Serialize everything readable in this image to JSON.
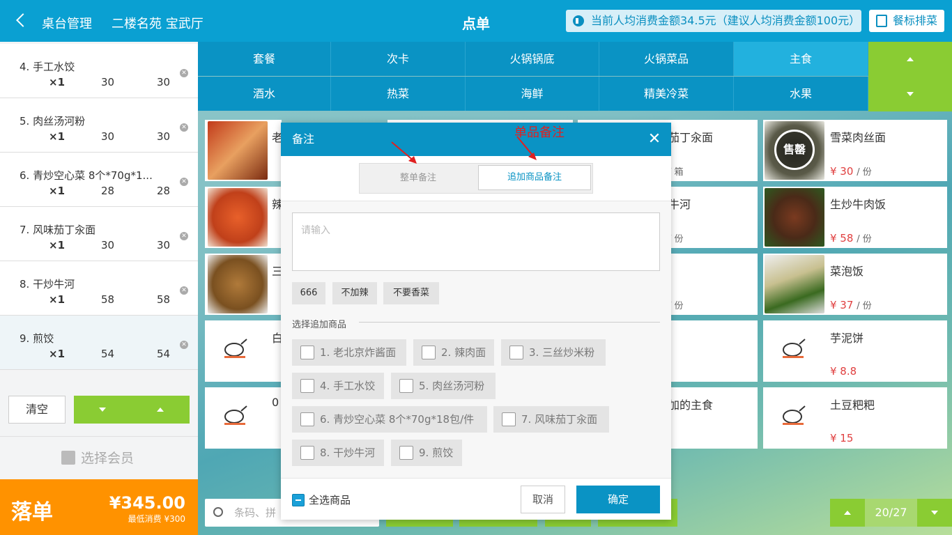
{
  "header": {
    "back_label": "桌台管理",
    "table_name": "二楼名苑 宝武厅",
    "title": "点单",
    "notice": "当前人均消费金额34.5元（建议人均消费金额100元）",
    "badge_sort": "餐标排菜"
  },
  "order": {
    "items": [
      {
        "name": "4. 手工水饺",
        "qty": "×1",
        "price": "30",
        "total": "30"
      },
      {
        "name": "5. 肉丝汤河粉",
        "qty": "×1",
        "price": "30",
        "total": "30"
      },
      {
        "name": "6. 青炒空心菜 8个*70g*1...",
        "qty": "×1",
        "price": "28",
        "total": "28"
      },
      {
        "name": "7. 风味茄丁汆面",
        "qty": "×1",
        "price": "30",
        "total": "30"
      },
      {
        "name": "8. 干炒牛河",
        "qty": "×1",
        "price": "58",
        "total": "58"
      },
      {
        "name": "9. 煎饺",
        "qty": "×1",
        "price": "54",
        "total": "54"
      }
    ],
    "clear": "清空",
    "member": "选择会员",
    "submit": "落单",
    "amount": "¥345.00",
    "min_spend": "最低消费 ¥300"
  },
  "categories": [
    "套餐",
    "次卡",
    "火锅锅底",
    "火锅菜品",
    "主食",
    "酒水",
    "热菜",
    "海鲜",
    "精美冷菜",
    "水果"
  ],
  "dishes_visible": [
    {
      "name": "茄丁汆面",
      "price": "",
      "unit": "/ 箱"
    },
    {
      "name": "雪菜肉丝面",
      "price": "¥ 30",
      "unit": "/ 份",
      "badge": "售罄"
    },
    {
      "name": "牛河",
      "price": "",
      "unit": "/ 份"
    },
    {
      "name": "生炒牛肉饭",
      "price": "¥ 58",
      "unit": "/ 份"
    },
    {
      "name": "",
      "price": "",
      "unit": "/ 份"
    },
    {
      "name": "菜泡饭",
      "price": "¥ 37",
      "unit": "/ 份"
    },
    {
      "name": "芋泥饼",
      "price": "¥ 8.8",
      "unit": ""
    },
    {
      "name": "加的主食",
      "price": "",
      "unit": ""
    },
    {
      "name": "土豆粑粑",
      "price": "¥ 15",
      "unit": ""
    }
  ],
  "dish_left_fragments": [
    "老",
    "辣",
    "三",
    "白",
    "0"
  ],
  "search": {
    "placeholder": "条码、拼"
  },
  "pager": {
    "text": "20/27"
  },
  "modal": {
    "title": "备注",
    "tab_whole": "整单备注",
    "tab_item": "追加商品备注",
    "placeholder": "请输入",
    "quick": [
      "666",
      "不加辣",
      "不要香菜"
    ],
    "section": "选择追加商品",
    "items": [
      "1. 老北京炸酱面",
      "2. 辣肉面",
      "3. 三丝炒米粉",
      "4. 手工水饺",
      "5. 肉丝汤河粉",
      "6. 青炒空心菜 8个*70g*18包/件",
      "7. 风味茄丁汆面",
      "8. 干炒牛河",
      "9. 煎饺"
    ],
    "select_all": "全选商品",
    "cancel": "取消",
    "confirm": "确定"
  },
  "annotation": "单品备注",
  "colors": {
    "primary": "#0a93c4",
    "green": "#8acc33",
    "orange": "#ff9200",
    "price": "#e04040"
  }
}
